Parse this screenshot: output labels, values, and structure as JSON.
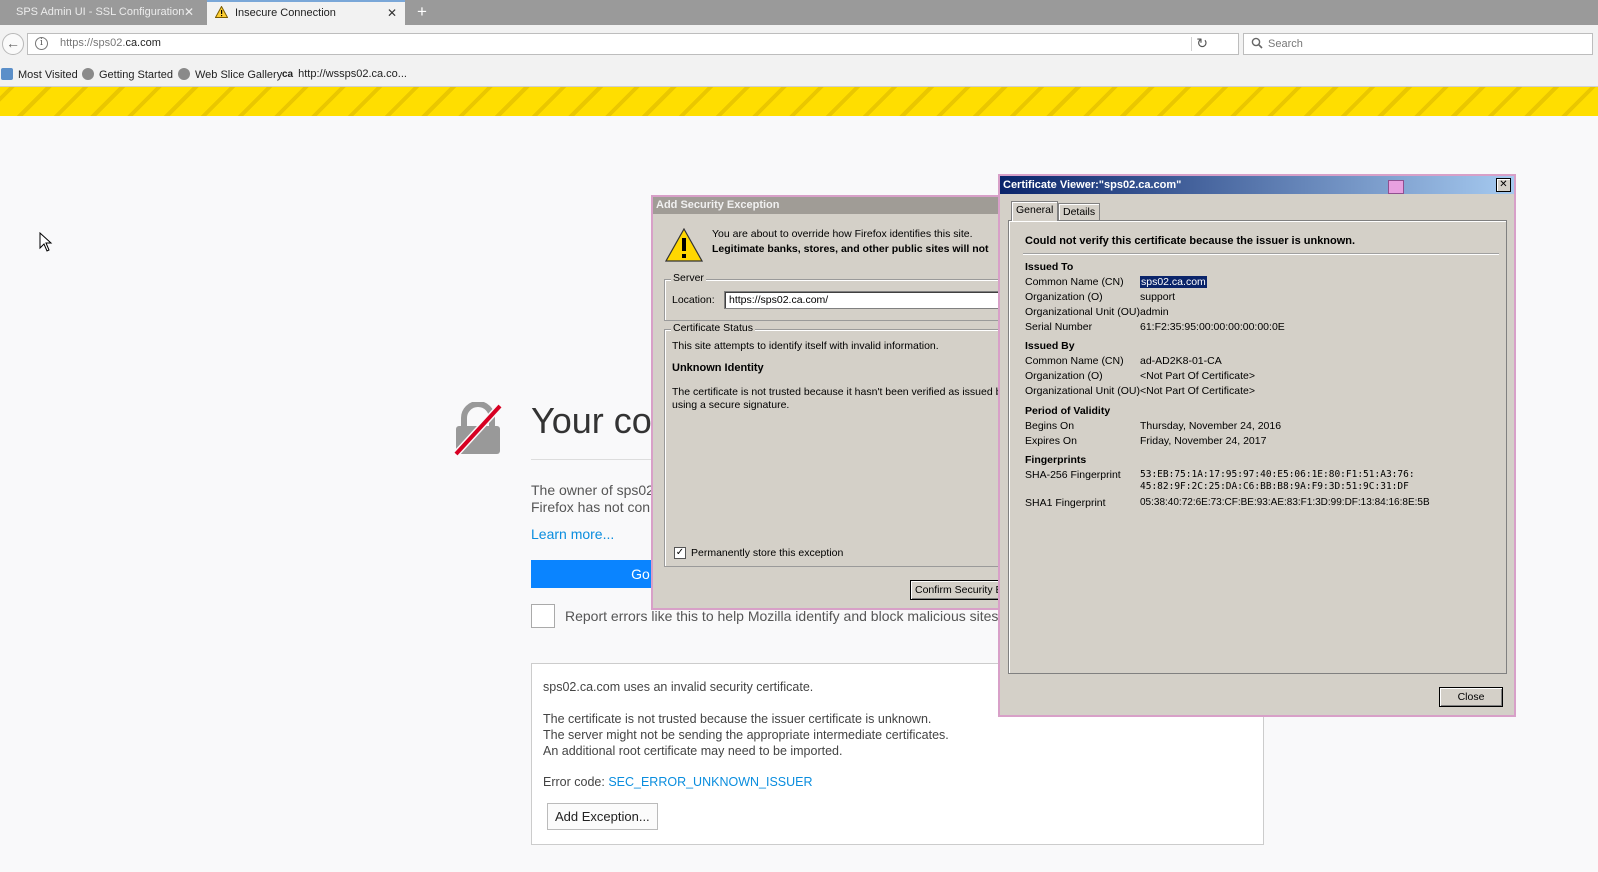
{
  "browser": {
    "tabs": [
      {
        "label": "SPS Admin UI - SSL Configuration",
        "close": "✕"
      },
      {
        "label": "Insecure Connection",
        "close": "✕"
      }
    ],
    "new_tab": "+",
    "url_prefix": "https://sps02.",
    "url_domain": "ca.com",
    "search_placeholder": "Search",
    "bookmarks": [
      "Most Visited",
      "Getting Started",
      "Web Slice Gallery",
      "http://wssps02.ca.co..."
    ]
  },
  "error_page": {
    "title": "Your co",
    "desc_line1": "The owner of sps02",
    "desc_line2": "Firefox has not con",
    "learn_more": "Learn more...",
    "go_back": "Go B",
    "report_text": "Report errors like this to help Mozilla identify and block malicious sites",
    "advanced": {
      "line1": "sps02.ca.com uses an invalid security certificate.",
      "line2": "The certificate is not trusted because the issuer certificate is unknown.",
      "line3": "The server might not be sending the appropriate intermediate certificates.",
      "line4": "An additional root certificate may need to be imported.",
      "error_code_label": "Error code: ",
      "error_code": "SEC_ERROR_UNKNOWN_ISSUER",
      "add_exception": "Add Exception..."
    }
  },
  "add_exception_dialog": {
    "title": "Add Security Exception",
    "intro1": "You are about to override how Firefox identifies this site.",
    "intro2": "Legitimate banks, stores, and other public sites will not",
    "server_group": "Server",
    "location_label": "Location:",
    "location_value": "https://sps02.ca.com/",
    "status_group": "Certificate Status",
    "status_line": "This site attempts to identify itself with invalid information.",
    "unknown_identity": "Unknown Identity",
    "not_trusted1": "The certificate is not trusted because it hasn't been verified as issued by",
    "not_trusted2": "using a secure signature.",
    "permanent_label": "Permanently store this exception",
    "permanent_checked": "✓",
    "confirm_button": "Confirm Security Ex"
  },
  "certificate_viewer": {
    "title": "Certificate Viewer:\"sps02.ca.com\"",
    "close_x": "✕",
    "tabs": [
      "General",
      "Details"
    ],
    "verify_msg": "Could not verify this certificate because the issuer is unknown.",
    "issued_to": {
      "heading": "Issued To",
      "rows": [
        {
          "label": "Common Name (CN)",
          "value": "sps02.ca.com"
        },
        {
          "label": "Organization (O)",
          "value": "support"
        },
        {
          "label": "Organizational Unit (OU)",
          "value": "admin"
        },
        {
          "label": "Serial Number",
          "value": "61:F2:35:95:00:00:00:00:00:0E"
        }
      ]
    },
    "issued_by": {
      "heading": "Issued By",
      "rows": [
        {
          "label": "Common Name (CN)",
          "value": "ad-AD2K8-01-CA"
        },
        {
          "label": "Organization (O)",
          "value": "<Not Part Of Certificate>"
        },
        {
          "label": "Organizational Unit (OU)",
          "value": "<Not Part Of Certificate>"
        }
      ]
    },
    "validity": {
      "heading": "Period of Validity",
      "rows": [
        {
          "label": "Begins On",
          "value": "Thursday, November 24, 2016"
        },
        {
          "label": "Expires On",
          "value": "Friday, November 24, 2017"
        }
      ]
    },
    "fingerprints": {
      "heading": "Fingerprints",
      "sha256_label": "SHA-256 Fingerprint",
      "sha256_line1": "53:EB:75:1A:17:95:97:40:E5:06:1E:80:F1:51:A3:76:",
      "sha256_line2": "45:82:9F:2C:25:DA:C6:BB:B8:9A:F9:3D:51:9C:31:DF",
      "sha1_label": "SHA1 Fingerprint",
      "sha1_value": "05:38:40:72:6E:73:CF:BE:93:AE:83:F1:3D:99:DF:13:84:16:8E:5B"
    },
    "close_button": "Close"
  },
  "colors": {
    "hazard_yellow": "#ffde00",
    "primary_blue": "#0a84ff",
    "link_blue": "#0a8dde",
    "dialog_gray": "#d4d0c8"
  }
}
